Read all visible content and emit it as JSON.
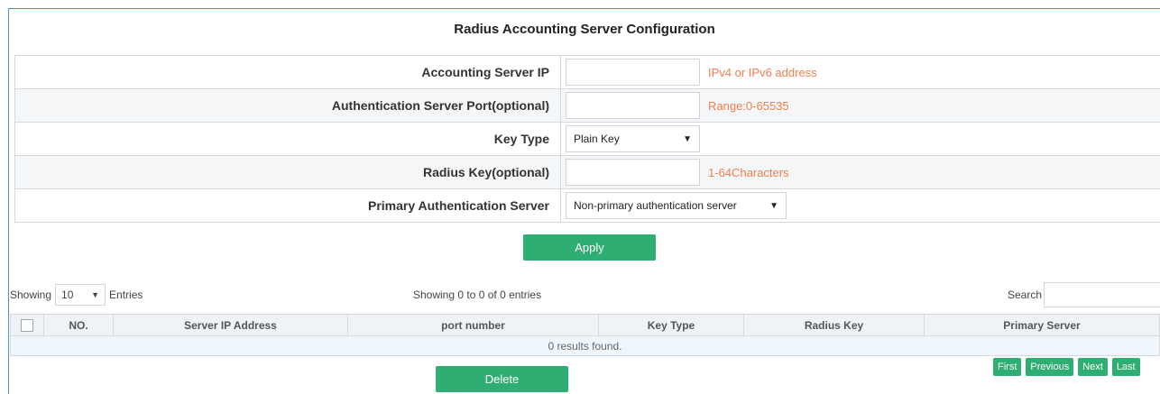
{
  "title": "Radius Accounting Server Configuration",
  "form": {
    "server_ip": {
      "label": "Accounting Server IP",
      "value": "",
      "hint": "IPv4 or IPv6 address"
    },
    "port": {
      "label": "Authentication Server Port(optional)",
      "value": "",
      "hint": "Range:0-65535"
    },
    "key_type": {
      "label": "Key Type",
      "selected": "Plain Key"
    },
    "radius_key": {
      "label": "Radius Key(optional)",
      "value": "",
      "hint": "1-64Characters"
    },
    "primary": {
      "label": "Primary Authentication Server",
      "selected": "Non-primary authentication server"
    }
  },
  "apply_label": "Apply",
  "table_controls": {
    "showing_prefix": "Showing",
    "page_size": "10",
    "entries_suffix": "Entries",
    "info": "Showing 0 to 0 of 0 entries",
    "search_label": "Search",
    "search_value": ""
  },
  "table": {
    "columns": [
      "NO.",
      "Server IP Address",
      "port number",
      "Key Type",
      "Radius Key",
      "Primary Server"
    ],
    "empty_message": "0 results found."
  },
  "delete_label": "Delete",
  "pager": {
    "first": "First",
    "previous": "Previous",
    "next": "Next",
    "last": "Last"
  },
  "colors": {
    "accent": "#2fae73",
    "hint": "#f07f4f",
    "frame": "#4a90d9"
  }
}
